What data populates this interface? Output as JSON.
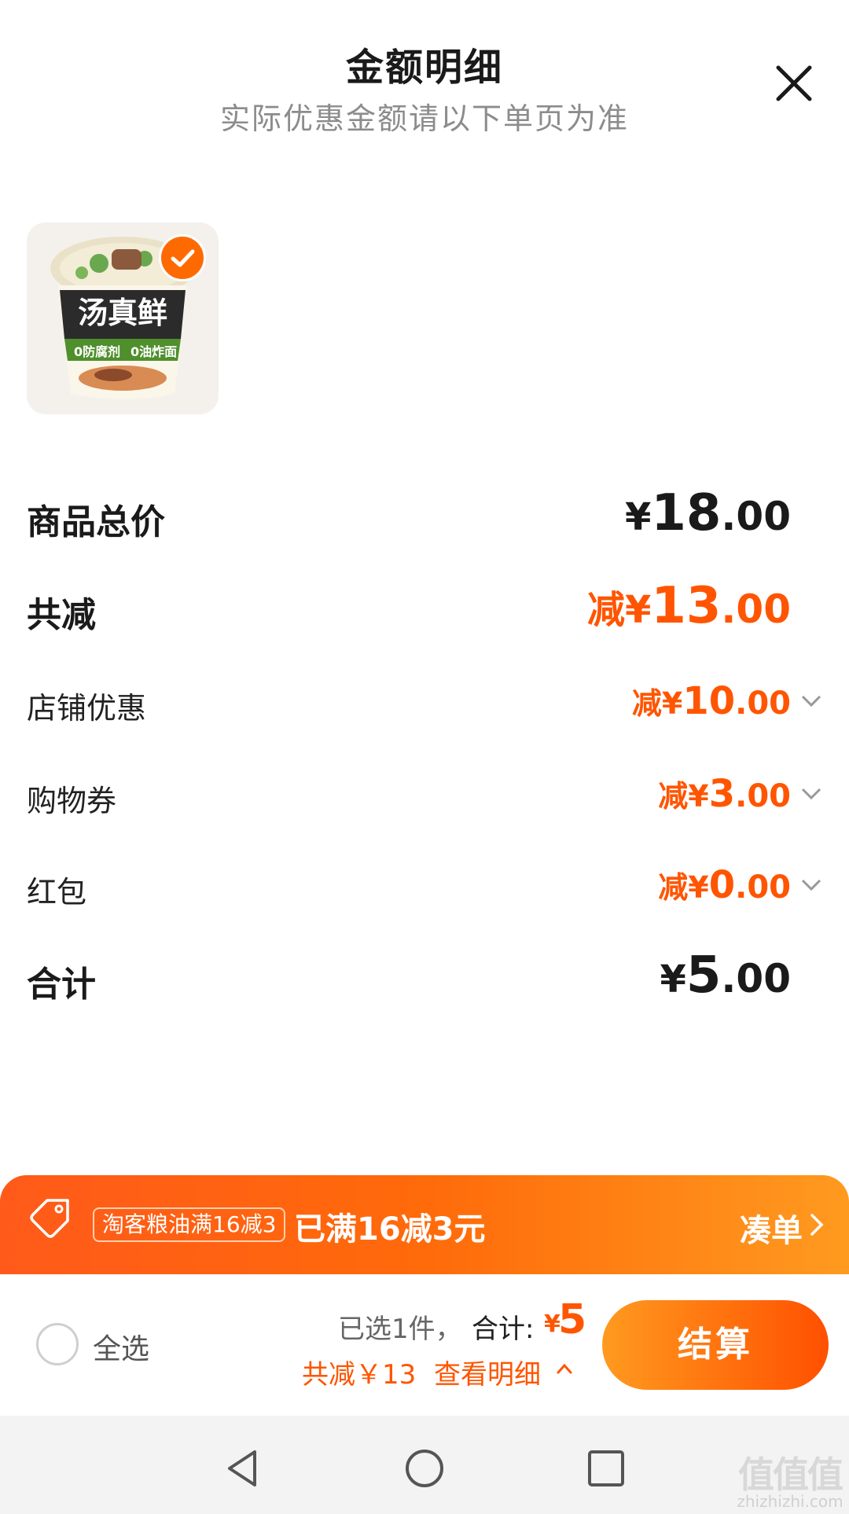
{
  "header": {
    "title": "金额明细",
    "subtitle": "实际优惠金额请以下单页为准"
  },
  "product": {
    "image_text": "汤真鲜",
    "image_sub_left": "0防腐剂",
    "image_sub_right": "0油炸面",
    "selected": true
  },
  "breakdown": {
    "total": {
      "label": "商品总价",
      "yen": "¥",
      "int": "18",
      "dec": ".00"
    },
    "discount": {
      "label": "共减",
      "prefix": "减¥",
      "int": "13",
      "dec": ".00"
    },
    "items": [
      {
        "label": "店铺优惠",
        "prefix": "减¥",
        "int": "10",
        "dec": ".00"
      },
      {
        "label": "购物券",
        "prefix": "减¥",
        "int": "3",
        "dec": ".00"
      },
      {
        "label": "红包",
        "prefix": "减¥",
        "int": "0",
        "dec": ".00"
      }
    ],
    "sum": {
      "label": "合计",
      "yen": "¥",
      "int": "5",
      "dec": ".00"
    }
  },
  "promo": {
    "badge": "淘客粮油满16减3",
    "text": "已满16减3元",
    "link": "凑单"
  },
  "footer": {
    "select_all": "全选",
    "selected_info": "已选1件，",
    "sum_label": "合计:",
    "sum_yen": "¥",
    "sum_value": "5",
    "saved": "共减￥13",
    "detail_link": "查看明细",
    "checkout": "结算"
  },
  "watermark": {
    "logo": "值值值",
    "url": "zhizhizhi.com"
  },
  "colors": {
    "accent": "#ff5500",
    "brand_gradient_start": "#ff9a1f",
    "brand_gradient_end": "#ff5000"
  }
}
